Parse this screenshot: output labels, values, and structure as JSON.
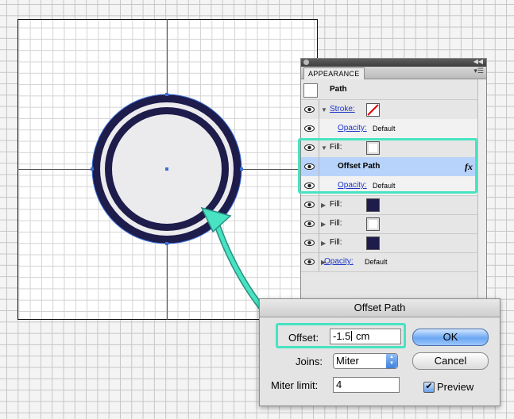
{
  "colors": {
    "accent_teal": "#47e3c2",
    "circle_navy": "#1e1c4b",
    "circle_fill": "#ebebee",
    "selection_blue": "#3b6fd6",
    "row_selected": "#b8d3fb"
  },
  "appearance_panel": {
    "tab": "APPEARANCE",
    "object_type": "Path",
    "rows": [
      {
        "label": "Stroke:",
        "linked": true,
        "swatch": "none-slash",
        "expanded": true
      },
      {
        "label": "Opacity:",
        "linked": true,
        "value": "Default",
        "indent": true
      },
      {
        "label": "Fill:",
        "linked": false,
        "swatch": "white",
        "expanded": true
      },
      {
        "label": "Offset Path",
        "effect": true,
        "fx": "fx",
        "selected": true,
        "indent": true
      },
      {
        "label": "Opacity:",
        "linked": true,
        "value": "Default",
        "indent": true
      },
      {
        "label": "Fill:",
        "linked": false,
        "swatch": "navy",
        "expanded": false
      },
      {
        "label": "Fill:",
        "linked": false,
        "swatch": "white",
        "expanded": false
      },
      {
        "label": "Fill:",
        "linked": false,
        "swatch": "navy",
        "expanded": false
      },
      {
        "label": "Opacity:",
        "linked": true,
        "value": "Default",
        "indent": false
      }
    ]
  },
  "offset_dialog": {
    "title": "Offset Path",
    "offset_label": "Offset:",
    "offset_value_before_caret": "-1.5",
    "offset_value_after_caret": " cm",
    "joins_label": "Joins:",
    "joins_value": "Miter",
    "miter_label": "Miter limit:",
    "miter_value": "4",
    "ok_label": "OK",
    "cancel_label": "Cancel",
    "preview_label": "Preview",
    "preview_checked": true
  }
}
